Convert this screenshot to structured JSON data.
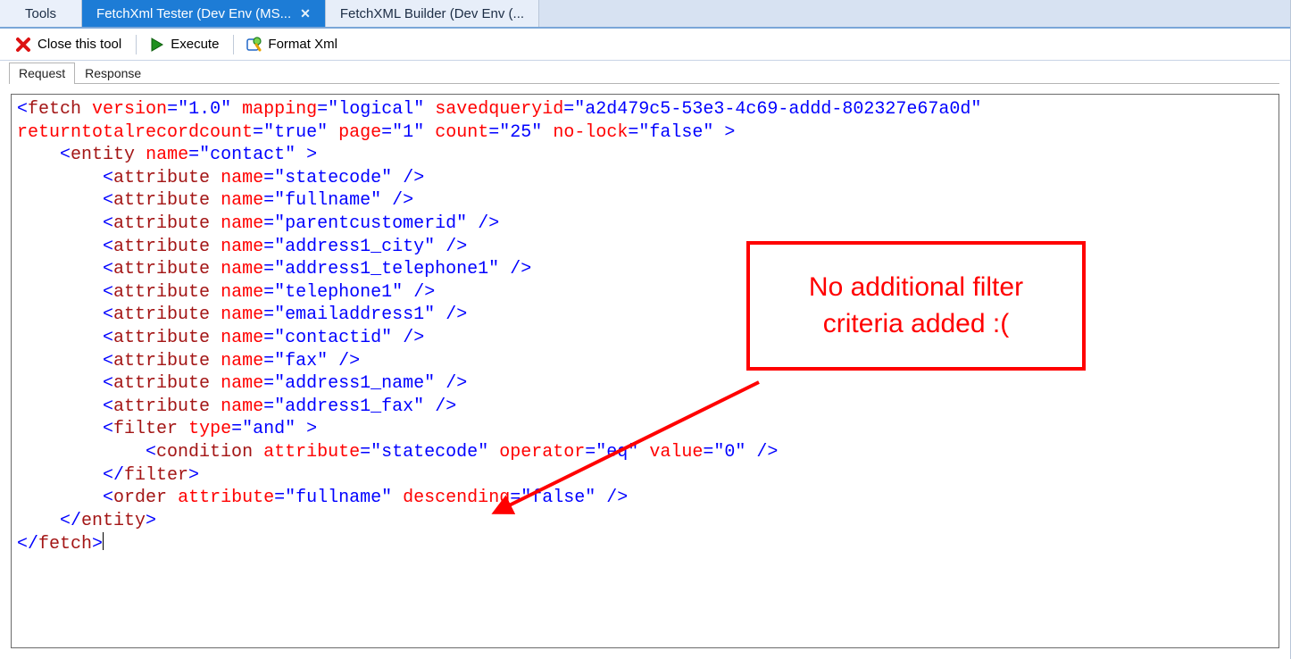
{
  "tabs": {
    "tools": "Tools",
    "active": "FetchXml Tester (Dev Env (MS...",
    "builder": "FetchXML Builder (Dev Env (..."
  },
  "toolbar": {
    "close": "Close this tool",
    "execute": "Execute",
    "formatxml": "Format Xml"
  },
  "subtabs": {
    "request": "Request",
    "response": "Response"
  },
  "callout": {
    "line1": "No additional filter",
    "line2": "criteria added :("
  },
  "xml": {
    "fetch_attrs": [
      {
        "name": "version",
        "value": "1.0"
      },
      {
        "name": "mapping",
        "value": "logical"
      },
      {
        "name": "savedqueryid",
        "value": "a2d479c5-53e3-4c69-addd-802327e67a0d"
      },
      {
        "name": "returntotalrecordcount",
        "value": "true"
      },
      {
        "name": "page",
        "value": "1"
      },
      {
        "name": "count",
        "value": "25"
      },
      {
        "name": "no-lock",
        "value": "false"
      }
    ],
    "entity_name": "contact",
    "attributes": [
      "statecode",
      "fullname",
      "parentcustomerid",
      "address1_city",
      "address1_telephone1",
      "telephone1",
      "emailaddress1",
      "contactid",
      "fax",
      "address1_name",
      "address1_fax"
    ],
    "filter_type": "and",
    "condition": {
      "attribute": "statecode",
      "operator": "eq",
      "value": "0"
    },
    "order": {
      "attribute": "fullname",
      "descending": "false"
    }
  }
}
